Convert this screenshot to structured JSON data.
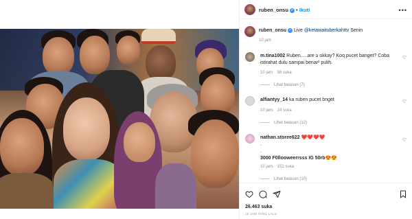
{
  "post": {
    "username": "ruben_onsu",
    "follow_label": "Ikuti",
    "caption_user": "ruben_onsu",
    "caption_live": "Live",
    "caption_mention": "@ketawaituberkahttv",
    "caption_rest": "Senin",
    "caption_time": "10 jam"
  },
  "comments": [
    {
      "user": "m.tina1002",
      "text1": "Ruben.....are u okkay? Koq pucet banget? Coba",
      "text2": "istirahat dulu sampai benar² pulih.",
      "time": "10 jam",
      "likes": "58 suka",
      "replies": "Lihat balasan (7)"
    },
    {
      "user": "alfiantyy_14",
      "text1": "ka ruben pucet bnget",
      "time": "10 jam",
      "likes": "24 suka",
      "replies": "Lihat balasan (12)"
    },
    {
      "user": "nathan.storee622",
      "text1": "❤️❤️❤️❤️",
      "dot1": ".",
      "dot2": ".",
      "text3": "3000 F0llooweerrsss IG 50rb😍😍",
      "time": "10 jam",
      "likes": "151 suka",
      "replies": "Lihat balasan (10)"
    }
  ],
  "footer": {
    "likes": "26.463 suka",
    "ago": "10 JAM YANG LALU"
  },
  "icons": {
    "more": "more-options-icon",
    "like": "heart-icon",
    "comment": "comment-icon",
    "share": "share-icon",
    "save": "bookmark-icon"
  }
}
